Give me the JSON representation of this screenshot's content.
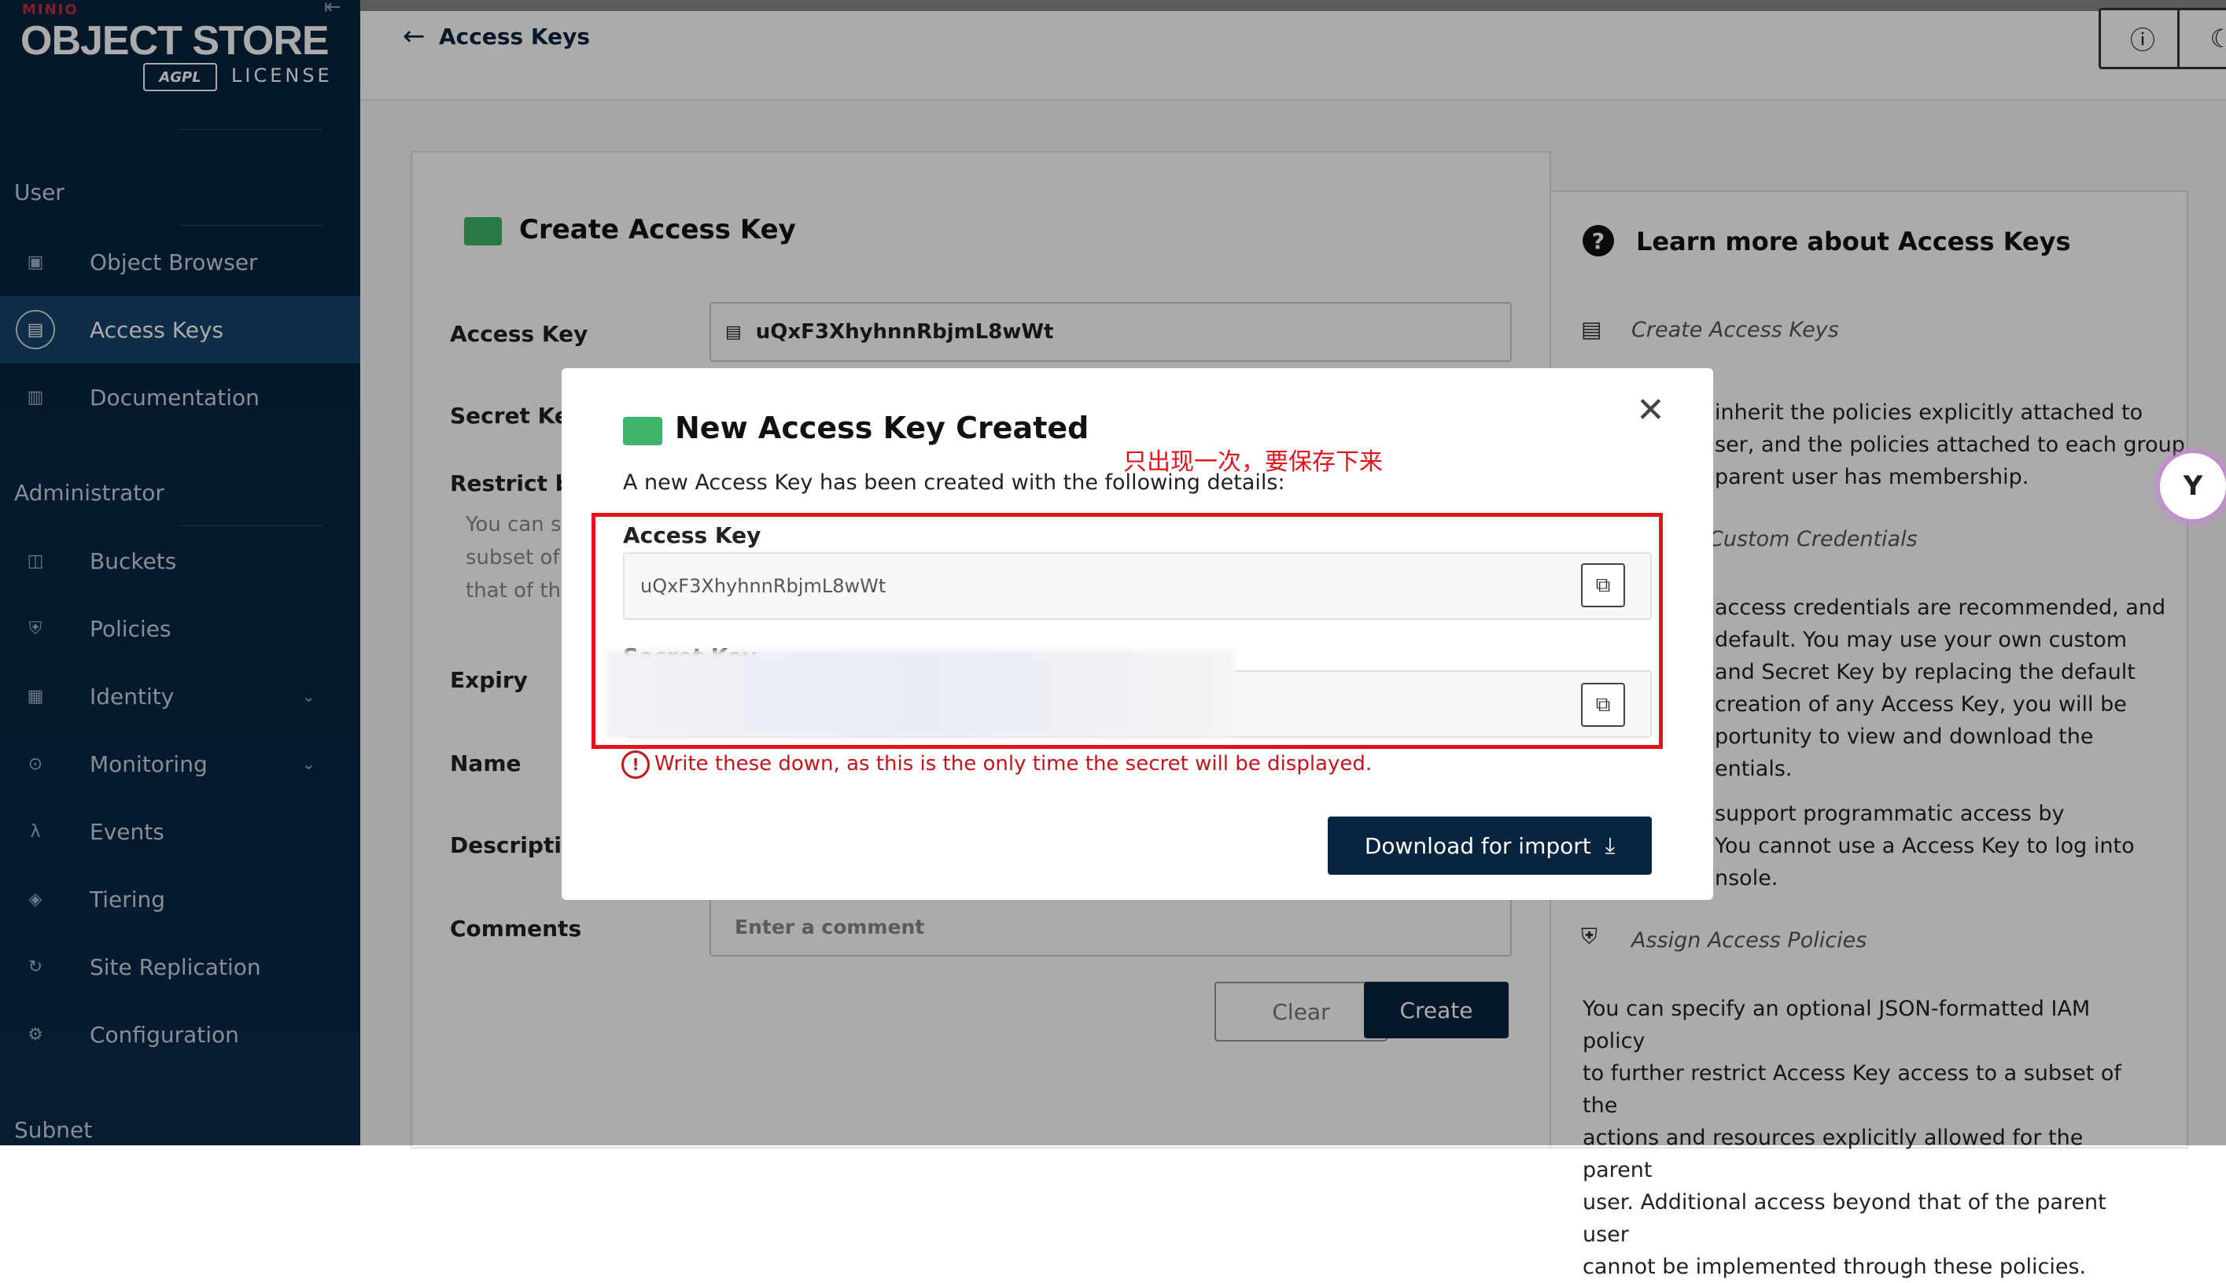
{
  "app": {
    "logo_small": "MINIO",
    "logo_main": "OBJECT STORE",
    "logo_badge": "AGPL",
    "logo_license": "LICENSE"
  },
  "sidebar": {
    "section_user": "User",
    "section_admin": "Administrator",
    "section_subnet": "Subnet",
    "items": [
      {
        "label": "Object Browser",
        "icon": "object-browser-icon"
      },
      {
        "label": "Access Keys",
        "icon": "access-keys-icon",
        "active": true
      },
      {
        "label": "Documentation",
        "icon": "documentation-icon"
      },
      {
        "label": "Buckets",
        "icon": "buckets-icon"
      },
      {
        "label": "Policies",
        "icon": "policies-icon"
      },
      {
        "label": "Identity",
        "icon": "identity-icon",
        "expandable": true
      },
      {
        "label": "Monitoring",
        "icon": "monitoring-icon",
        "expandable": true
      },
      {
        "label": "Events",
        "icon": "lambda-icon"
      },
      {
        "label": "Tiering",
        "icon": "tiering-icon"
      },
      {
        "label": "Site Replication",
        "icon": "replication-icon"
      },
      {
        "label": "Configuration",
        "icon": "gear-icon"
      }
    ]
  },
  "header": {
    "breadcrumb": "Access Keys"
  },
  "form": {
    "title": "Create Access Key",
    "access_key_label": "Access Key",
    "access_key_value": "uQxF3XhyhnnRbjmL8wWt",
    "secret_key_label": "Secret Key",
    "restrict_label": "Restrict be",
    "restrict_help_1": "You can s",
    "restrict_help_2": "subset of",
    "restrict_help_3": "that of th",
    "expiry_label": "Expiry",
    "name_label": "Name",
    "description_label": "Descriptio",
    "comments_label": "Comments",
    "comments_placeholder": "Enter a comment",
    "clear_button": "Clear",
    "create_button": "Create"
  },
  "help": {
    "title": "Learn more about Access Keys",
    "sub_create": "Create Access Keys",
    "text_1_lines": [
      "inherit the policies explicitly attached to",
      "ser, and the policies attached to each group",
      "parent user has membership."
    ],
    "sub_custom": "Custom Credentials",
    "text_2_lines": [
      "access credentials are recommended, and",
      "default. You may use your own custom",
      "and Secret Key by replacing the default",
      "creation of any Access Key, you will be",
      "portunity to view and download the",
      "entials."
    ],
    "text_3_lines": [
      "support programmatic access by",
      "You cannot use a Access Key to log into",
      "nsole."
    ],
    "sub_assign": "Assign Access Policies",
    "text_4_lines": [
      "You can specify an optional JSON-formatted IAM policy",
      "to further restrict Access Key access to a subset of the",
      "actions and resources explicitly allowed for the parent",
      "user. Additional access beyond that of the parent user",
      "cannot be implemented through these policies."
    ]
  },
  "modal": {
    "title": "New Access Key Created",
    "subtitle": "A new Access Key has been created with the following details:",
    "annotation": "只出现一次，要保存下来",
    "access_key_label": "Access Key",
    "access_key_value": "uQxF3XhyhnnRbjmL8wWt",
    "secret_key_label": "Secret Key",
    "warning": "Write these down, as this is the only time the secret will be displayed.",
    "download_button": "Download for import"
  }
}
